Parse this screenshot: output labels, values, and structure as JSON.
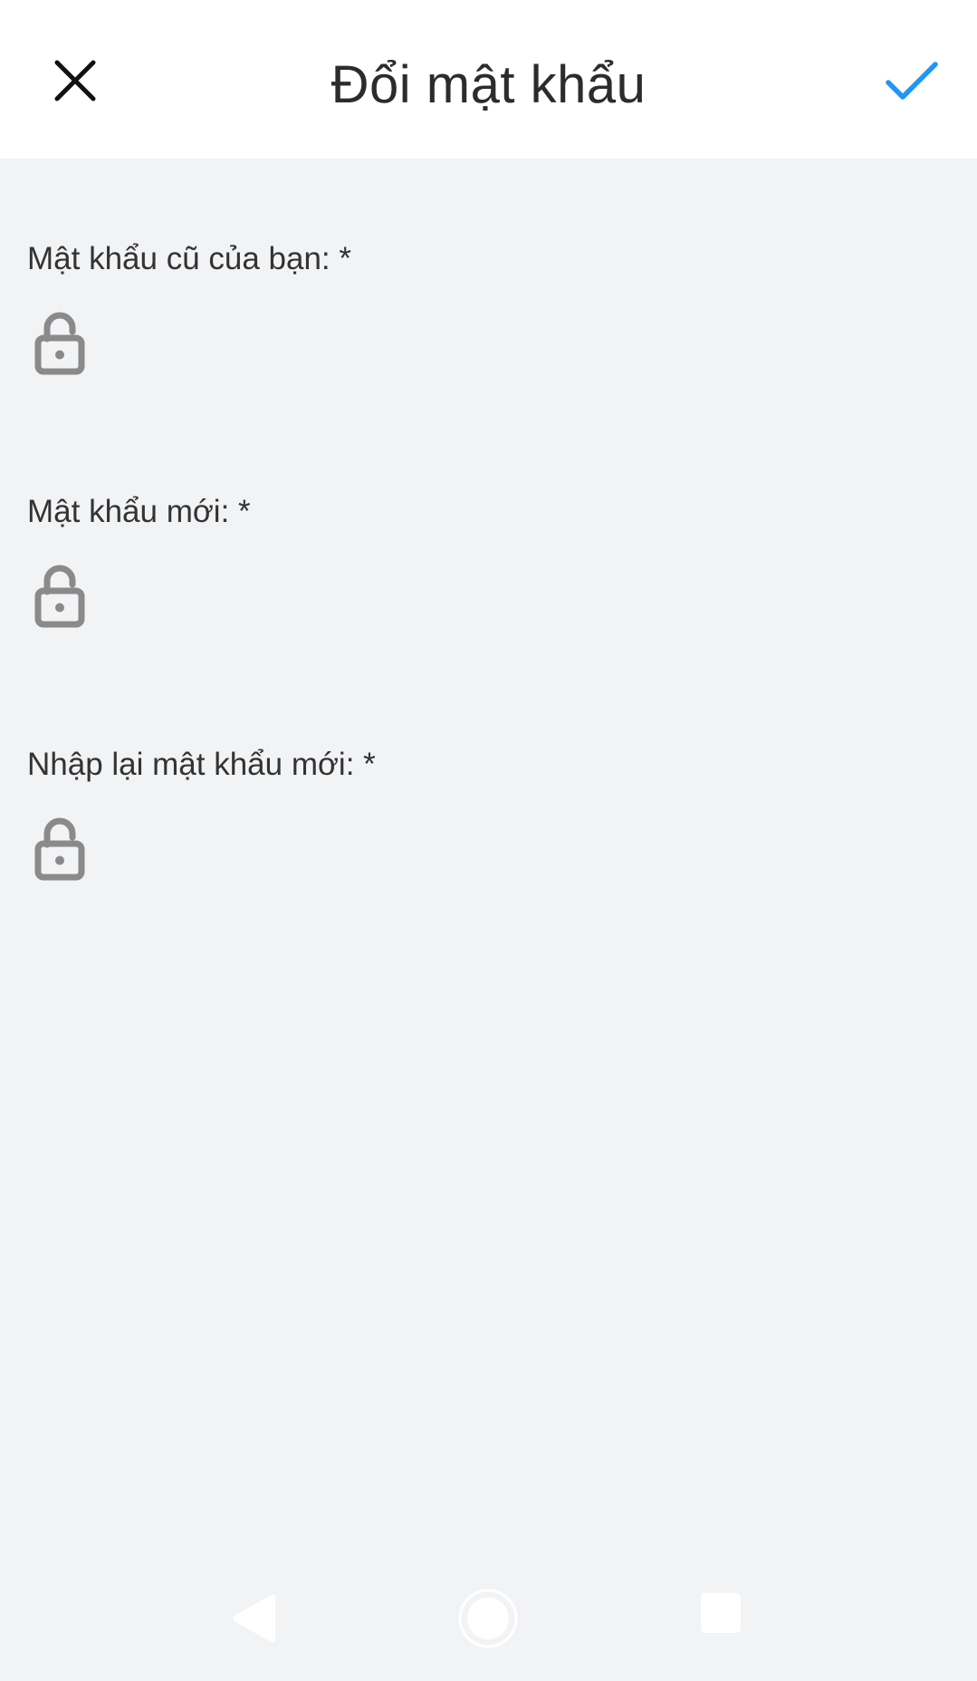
{
  "header": {
    "title": "Đổi mật khẩu",
    "close_icon": "close-icon",
    "confirm_icon": "checkmark-icon",
    "confirm_color": "#2196f3"
  },
  "form": {
    "fields": [
      {
        "label": "Mật khẩu cũ của bạn: *",
        "icon": "lock-icon",
        "value": ""
      },
      {
        "label": "Mật khẩu mới: *",
        "icon": "lock-icon",
        "value": ""
      },
      {
        "label": "Nhập lại mật khẩu mới: *",
        "icon": "lock-icon",
        "value": ""
      }
    ]
  },
  "system_nav": {
    "back_icon": "back-triangle-icon",
    "home_icon": "home-circle-icon",
    "recent_icon": "recent-apps-square-icon"
  },
  "colors": {
    "background": "#f2f3f5",
    "header_background": "#ffffff",
    "icon_gray": "#8a8a8a",
    "accent": "#2196f3"
  }
}
